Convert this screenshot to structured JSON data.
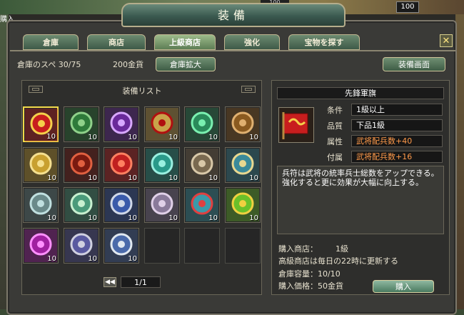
{
  "hud": {
    "top_left_text": "購入",
    "top_number": "100",
    "top_small_number": "100"
  },
  "window": {
    "title": "装備",
    "close_label": "✕"
  },
  "tabs": [
    {
      "label": "倉庫",
      "active": false
    },
    {
      "label": "商店",
      "active": false
    },
    {
      "label": "上級商店",
      "active": true
    },
    {
      "label": "強化",
      "active": false
    },
    {
      "label": "宝物を探す",
      "active": false
    }
  ],
  "info": {
    "storage_space": "倉庫のスペ 30/75",
    "gold": "200金貨",
    "expand_button": "倉庫拡大",
    "equip_screen_button": "装備画面"
  },
  "equipment_list": {
    "header": "装備リスト",
    "items": [
      {
        "name": "red-flag",
        "qty": "10",
        "selected": true
      },
      {
        "name": "green-tassel",
        "qty": "10"
      },
      {
        "name": "purple-talisman",
        "qty": "10"
      },
      {
        "name": "charm-scroll",
        "qty": "10"
      },
      {
        "name": "jade-tablet",
        "qty": "10"
      },
      {
        "name": "bronze-plaque",
        "qty": "10"
      },
      {
        "name": "golden-mace",
        "qty": "10"
      },
      {
        "name": "red-book",
        "qty": "10"
      },
      {
        "name": "red-parasol",
        "qty": "10"
      },
      {
        "name": "jade-teapot",
        "qty": "10"
      },
      {
        "name": "stone-pillar",
        "qty": "10"
      },
      {
        "name": "bronze-mirror",
        "qty": "10"
      },
      {
        "name": "silver-scepter",
        "qty": "10"
      },
      {
        "name": "jade-disc",
        "qty": "10"
      },
      {
        "name": "blue-coin",
        "qty": "10"
      },
      {
        "name": "stone-ring",
        "qty": "10"
      },
      {
        "name": "command-token",
        "qty": "10"
      },
      {
        "name": "imperial-scroll",
        "qty": "10"
      },
      {
        "name": "purple-seal",
        "qty": "10"
      },
      {
        "name": "dark-orb",
        "qty": "10"
      },
      {
        "name": "silver-mirror",
        "qty": "10"
      }
    ],
    "pager": {
      "prev": "◀◀",
      "page": "1/1",
      "next": "▶▶"
    }
  },
  "detail": {
    "name": "先鋒軍旗",
    "attributes": [
      {
        "label": "条件",
        "value": "1級以上",
        "highlight": false
      },
      {
        "label": "品質",
        "value": "下品1級",
        "highlight": false
      },
      {
        "label": "属性",
        "value": "武将配兵数+40",
        "highlight": true
      },
      {
        "label": "付属",
        "value": "武将配兵数+16",
        "highlight": true
      }
    ],
    "description": "兵符は武将の統率兵士総数をアップできる。強化すると更に効果が大幅に向上する。",
    "shop_label": "購入商店：",
    "shop_value": "1級",
    "refresh_note": "高級商店は毎日の22時に更新する",
    "capacity": "倉庫容量：10/10",
    "price": "購入価格：50金貨",
    "buy_button": "購入"
  },
  "colors": {
    "accent_gold": "#f2d94a",
    "attr_orange": "#ff9a4a",
    "tab_green": "#3e5a48"
  }
}
